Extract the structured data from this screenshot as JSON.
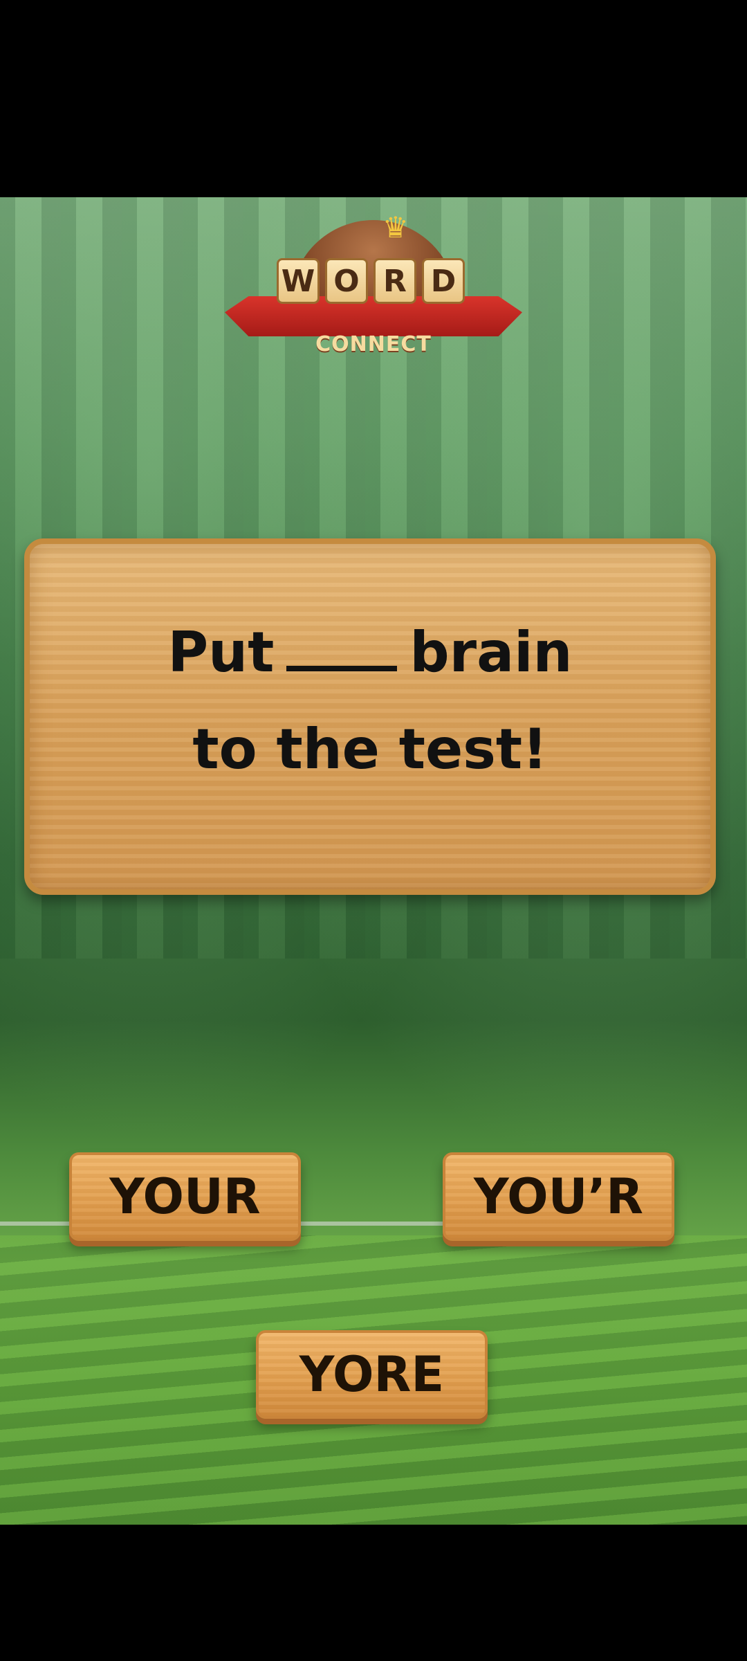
{
  "logo": {
    "tiles": [
      "W",
      "O",
      "R",
      "D"
    ],
    "subtitle": "CONNECT"
  },
  "question": {
    "line1_before": "Put",
    "line1_after": "brain",
    "line2": "to the test!"
  },
  "answers": [
    {
      "label": "YOUR"
    },
    {
      "label": "YOU’R"
    },
    {
      "label": "YORE"
    }
  ],
  "colors": {
    "board_wood": "#d9a15a",
    "button_wood": "#e29f4f",
    "text": "#111111",
    "ribbon_red": "#c42a22"
  }
}
